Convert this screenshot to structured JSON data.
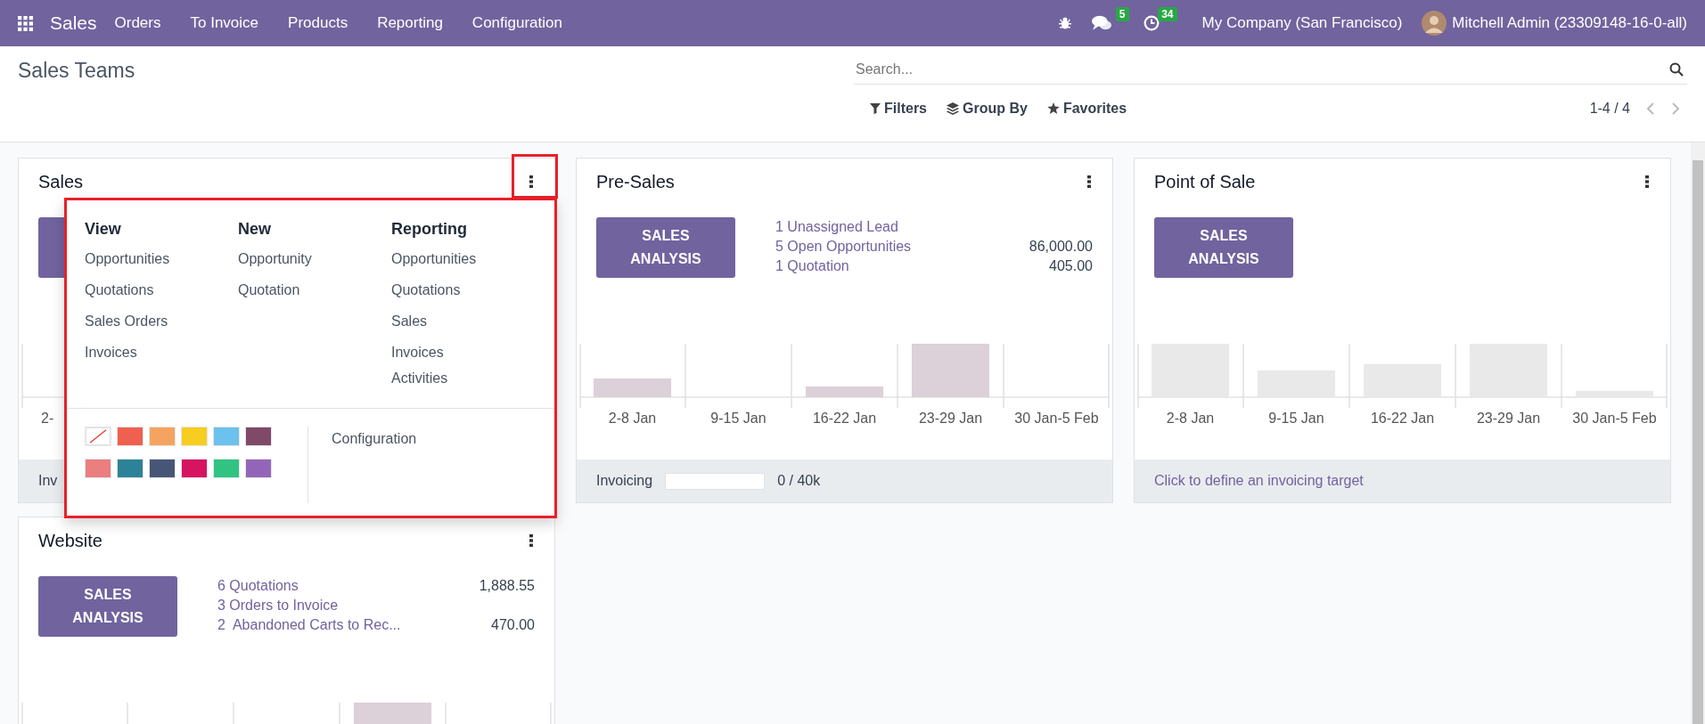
{
  "navbar": {
    "app_name": "Sales",
    "menu": [
      "Orders",
      "To Invoice",
      "Products",
      "Reporting",
      "Configuration"
    ],
    "messages_count": "5",
    "activities_count": "34",
    "company": "My Company (San Francisco)",
    "user": "Mitchell Admin (23309148-16-0-all)"
  },
  "control_panel": {
    "title": "Sales Teams",
    "search": {
      "placeholder": "Search..."
    },
    "filters": [
      {
        "label": "Filters",
        "kind": "filter"
      },
      {
        "label": "Group By",
        "kind": "layers"
      },
      {
        "label": "Favorites",
        "kind": "star"
      }
    ],
    "pager": "1-4 / 4"
  },
  "teams": [
    {
      "name": "Sales",
      "chart_labels": [
        "2-"
      ],
      "footer": {
        "kind": "cut",
        "label": "Inv"
      },
      "menu_open": true,
      "menu": {
        "columns": [
          {
            "heading": "View",
            "items": [
              "Opportunities",
              "Quotations",
              "Sales Orders",
              "Invoices"
            ]
          },
          {
            "heading": "New",
            "items": [
              "Opportunity",
              "Quotation"
            ]
          },
          {
            "heading": "Reporting",
            "items": [
              "Opportunities",
              "Quotations",
              "Sales",
              "Invoices",
              "Activities"
            ]
          }
        ],
        "colors": [
          {
            "kind": "none"
          },
          {
            "kind": "swatch",
            "color": "#f06050"
          },
          {
            "kind": "swatch",
            "color": "#f4a460"
          },
          {
            "kind": "swatch",
            "color": "#f7cd1f"
          },
          {
            "kind": "swatch",
            "color": "#6cc1ed"
          },
          {
            "kind": "swatch",
            "color": "#814968"
          },
          {
            "kind": "swatch",
            "color": "#eb7e7f"
          },
          {
            "kind": "swatch",
            "color": "#2c8397"
          },
          {
            "kind": "swatch",
            "color": "#475577"
          },
          {
            "kind": "swatch",
            "color": "#d6145f"
          },
          {
            "kind": "swatch",
            "color": "#30c381"
          },
          {
            "kind": "swatch",
            "color": "#9365b8"
          }
        ],
        "configuration": "Configuration"
      }
    },
    {
      "name": "Pre-Sales",
      "button": "SALES ANALYSIS",
      "menu_open": false,
      "stats": [
        {
          "label": "1 Unassigned Lead"
        },
        {
          "label": "5 Open Opportunities",
          "amount": "86,000.00"
        },
        {
          "label": "1 Quotation",
          "amount": "405.00"
        }
      ],
      "chart_labels": [
        "2-8 Jan",
        "9-15 Jan",
        "16-22 Jan",
        "23-29 Jan",
        "30 Jan-5 Feb"
      ],
      "footer": {
        "kind": "invoicing",
        "label": "Invoicing",
        "level": 0,
        "reading": "0 / 40k"
      }
    },
    {
      "name": "Point of Sale",
      "button": "SALES ANALYSIS",
      "menu_open": false,
      "chart_labels": [
        "2-8 Jan",
        "9-15 Jan",
        "16-22 Jan",
        "23-29 Jan",
        "30 Jan-5 Feb"
      ],
      "footer": {
        "kind": "target",
        "label": "Click to define an invoicing target"
      }
    },
    {
      "name": "Website",
      "button": "SALES ANALYSIS",
      "menu_open": false,
      "stats": [
        {
          "label": "6 Quotations",
          "amount": "1,888.55"
        },
        {
          "label": "3 Orders to Invoice"
        },
        {
          "label": "2  Abandoned Carts to Rec...",
          "amount": "470.00"
        }
      ]
    }
  ]
}
